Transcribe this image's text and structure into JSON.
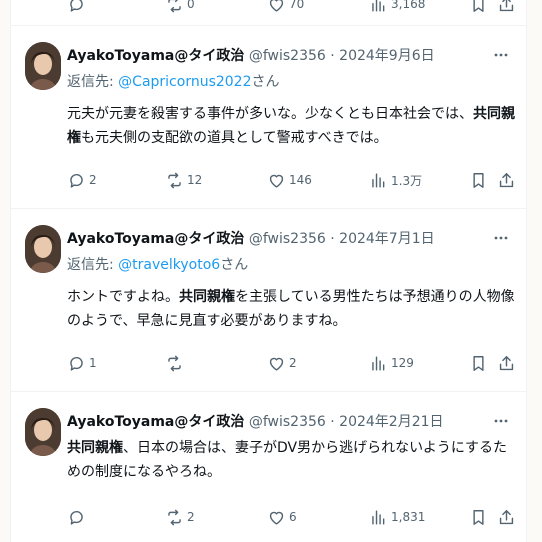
{
  "partial_tweet": {
    "retweet_count": "0",
    "like_count": "70",
    "view_count": "3,168"
  },
  "tweets": [
    {
      "display_name": "AyakoToyama@タイ政治",
      "handle": "@fwis2356",
      "separator": " · ",
      "date": "2024年9月6日",
      "reply_prefix": "返信先: ",
      "reply_handle": "@Capricornus2022",
      "reply_suffix": "さん",
      "text_1": "元夫が元妻を殺害する事件が多いな。少なくとも日本社会では、",
      "text_bold": "共同親権",
      "text_2": "も元夫側の支配欲の道具として警戒すべきでは。",
      "reply_count": "2",
      "retweet_count": "12",
      "like_count": "146",
      "view_count": "1.3万"
    },
    {
      "display_name": "AyakoToyama@タイ政治",
      "handle": "@fwis2356",
      "separator": " · ",
      "date": "2024年7月1日",
      "reply_prefix": "返信先: ",
      "reply_handle": "@travelkyoto6",
      "reply_suffix": "さん",
      "text_1": "ホントですよね。",
      "text_bold": "共同親権",
      "text_2": "を主張している男性たちは予想通りの人物像のようで、早急に見直す必要がありますね。",
      "reply_count": "1",
      "retweet_count": "",
      "like_count": "2",
      "view_count": "129"
    },
    {
      "display_name": "AyakoToyama@タイ政治",
      "handle": "@fwis2356",
      "separator": " · ",
      "date": "2024年2月21日",
      "text_bold": "共同親権",
      "text_2": "、日本の場合は、妻子がDV男から逃げられないようにするための制度になるやろね。",
      "reply_count": "",
      "retweet_count": "2",
      "like_count": "6",
      "view_count": "1,831"
    }
  ],
  "icons": {
    "reply": "reply-icon",
    "retweet": "retweet-icon",
    "like": "heart-icon",
    "views": "views-bar-chart-icon",
    "bookmark": "bookmark-icon",
    "share": "share-icon",
    "more": "more-dots-icon"
  },
  "colors": {
    "link": "#1d9bf0",
    "muted": "#536471",
    "text": "#0f1419"
  }
}
